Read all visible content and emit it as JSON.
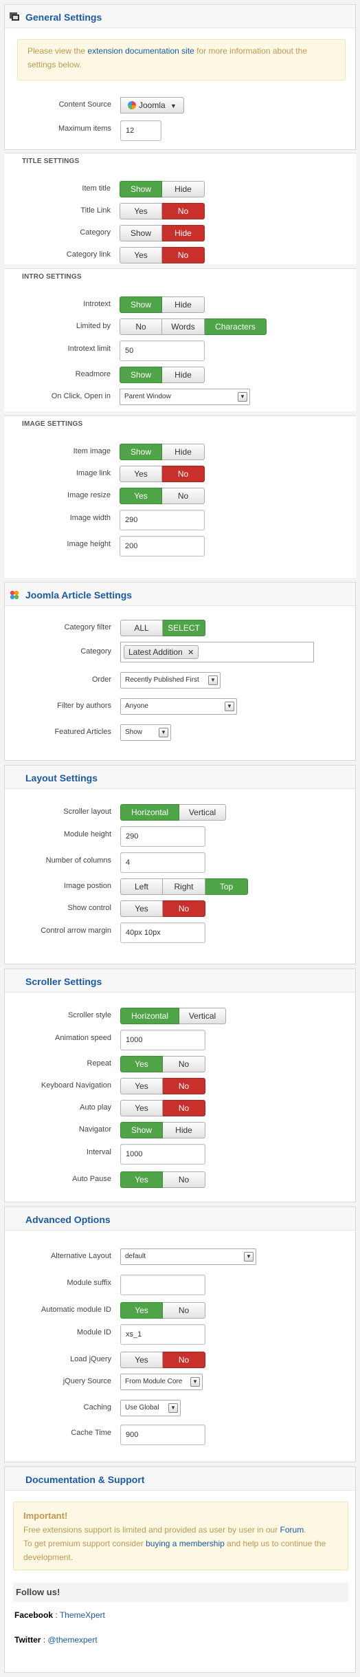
{
  "general": {
    "title": "General Settings",
    "note_prefix": "Please view the ",
    "note_link": "extension documentation site",
    "note_suffix": " for more information about the settings below.",
    "content_source_label": "Content Source",
    "content_source_value": "Joomla",
    "max_items_label": "Maximum items",
    "max_items_value": "12"
  },
  "title_settings": {
    "heading": "TITLE SETTINGS",
    "item_title_label": "Item title",
    "title_link_label": "Title Link",
    "category_label": "Category",
    "category_link_label": "Category link",
    "show": "Show",
    "hide": "Hide",
    "yes": "Yes",
    "no": "No"
  },
  "intro_settings": {
    "heading": "INTRO SETTINGS",
    "introtext_label": "Introtext",
    "limited_by_label": "Limited by",
    "limited_options": [
      "No",
      "Words",
      "Characters"
    ],
    "introtext_limit_label": "Introtext limit",
    "introtext_limit_value": "50",
    "readmore_label": "Readmore",
    "onclick_label": "On Click, Open in",
    "onclick_value": "Parent Window"
  },
  "image_settings": {
    "heading": "IMAGE SETTINGS",
    "item_image_label": "Item image",
    "image_link_label": "Image link",
    "image_resize_label": "Image resize",
    "image_width_label": "Image width",
    "image_width_value": "290",
    "image_height_label": "Image height",
    "image_height_value": "200"
  },
  "joomla": {
    "title": "Joomla Article Settings",
    "category_filter_label": "Category filter",
    "all": "ALL",
    "select": "SELECT",
    "category_label": "Category",
    "category_tag": "Latest Addition",
    "order_label": "Order",
    "order_value": "Recently Published First",
    "filter_authors_label": "Filter by authors",
    "filter_authors_value": "Anyone",
    "featured_label": "Featured Articles",
    "featured_value": "Show"
  },
  "layout": {
    "title": "Layout Settings",
    "scroller_layout_label": "Scroller layout",
    "horizontal": "Horizontal",
    "vertical": "Vertical",
    "module_height_label": "Module height",
    "module_height_value": "290",
    "columns_label": "Number of columns",
    "columns_value": "4",
    "image_position_label": "Image postion",
    "positions": [
      "Left",
      "Right",
      "Top"
    ],
    "show_control_label": "Show control",
    "arrow_margin_label": "Control arrow margin",
    "arrow_margin_value": "40px 10px"
  },
  "scroller": {
    "title": "Scroller Settings",
    "style_label": "Scroller style",
    "anim_speed_label": "Animation speed",
    "anim_speed_value": "1000",
    "repeat_label": "Repeat",
    "keyboard_label": "Keyboard Navigation",
    "autoplay_label": "Auto play",
    "navigator_label": "Navigator",
    "interval_label": "Interval",
    "interval_value": "1000",
    "autopause_label": "Auto Pause"
  },
  "advanced": {
    "title": "Advanced Options",
    "alt_layout_label": "Alternative Layout",
    "alt_layout_value": "default",
    "suffix_label": "Module suffix",
    "suffix_value": "",
    "auto_id_label": "Automatic module ID",
    "module_id_label": "Module ID",
    "module_id_value": "xs_1",
    "load_jquery_label": "Load jQuery",
    "jquery_source_label": "jQuery Source",
    "jquery_source_value": "From Module Core",
    "caching_label": "Caching",
    "caching_value": "Use Global",
    "cache_time_label": "Cache Time",
    "cache_time_value": "900"
  },
  "docs": {
    "title": "Documentation & Support",
    "important": "Important!",
    "line1_prefix": "Free extensions support is limited and provided as user by user in our ",
    "forum": "Forum",
    "line1_suffix": ".",
    "line2_prefix": "To get premium support consider ",
    "membership": "buying a membership",
    "line2_suffix": " and help us to continue the development.",
    "follow": "Follow us!",
    "facebook_label": "Facebook",
    "facebook_value": "ThemeXpert",
    "twitter_label": "Twitter",
    "twitter_value": "@themexpert",
    "sep": " : "
  }
}
